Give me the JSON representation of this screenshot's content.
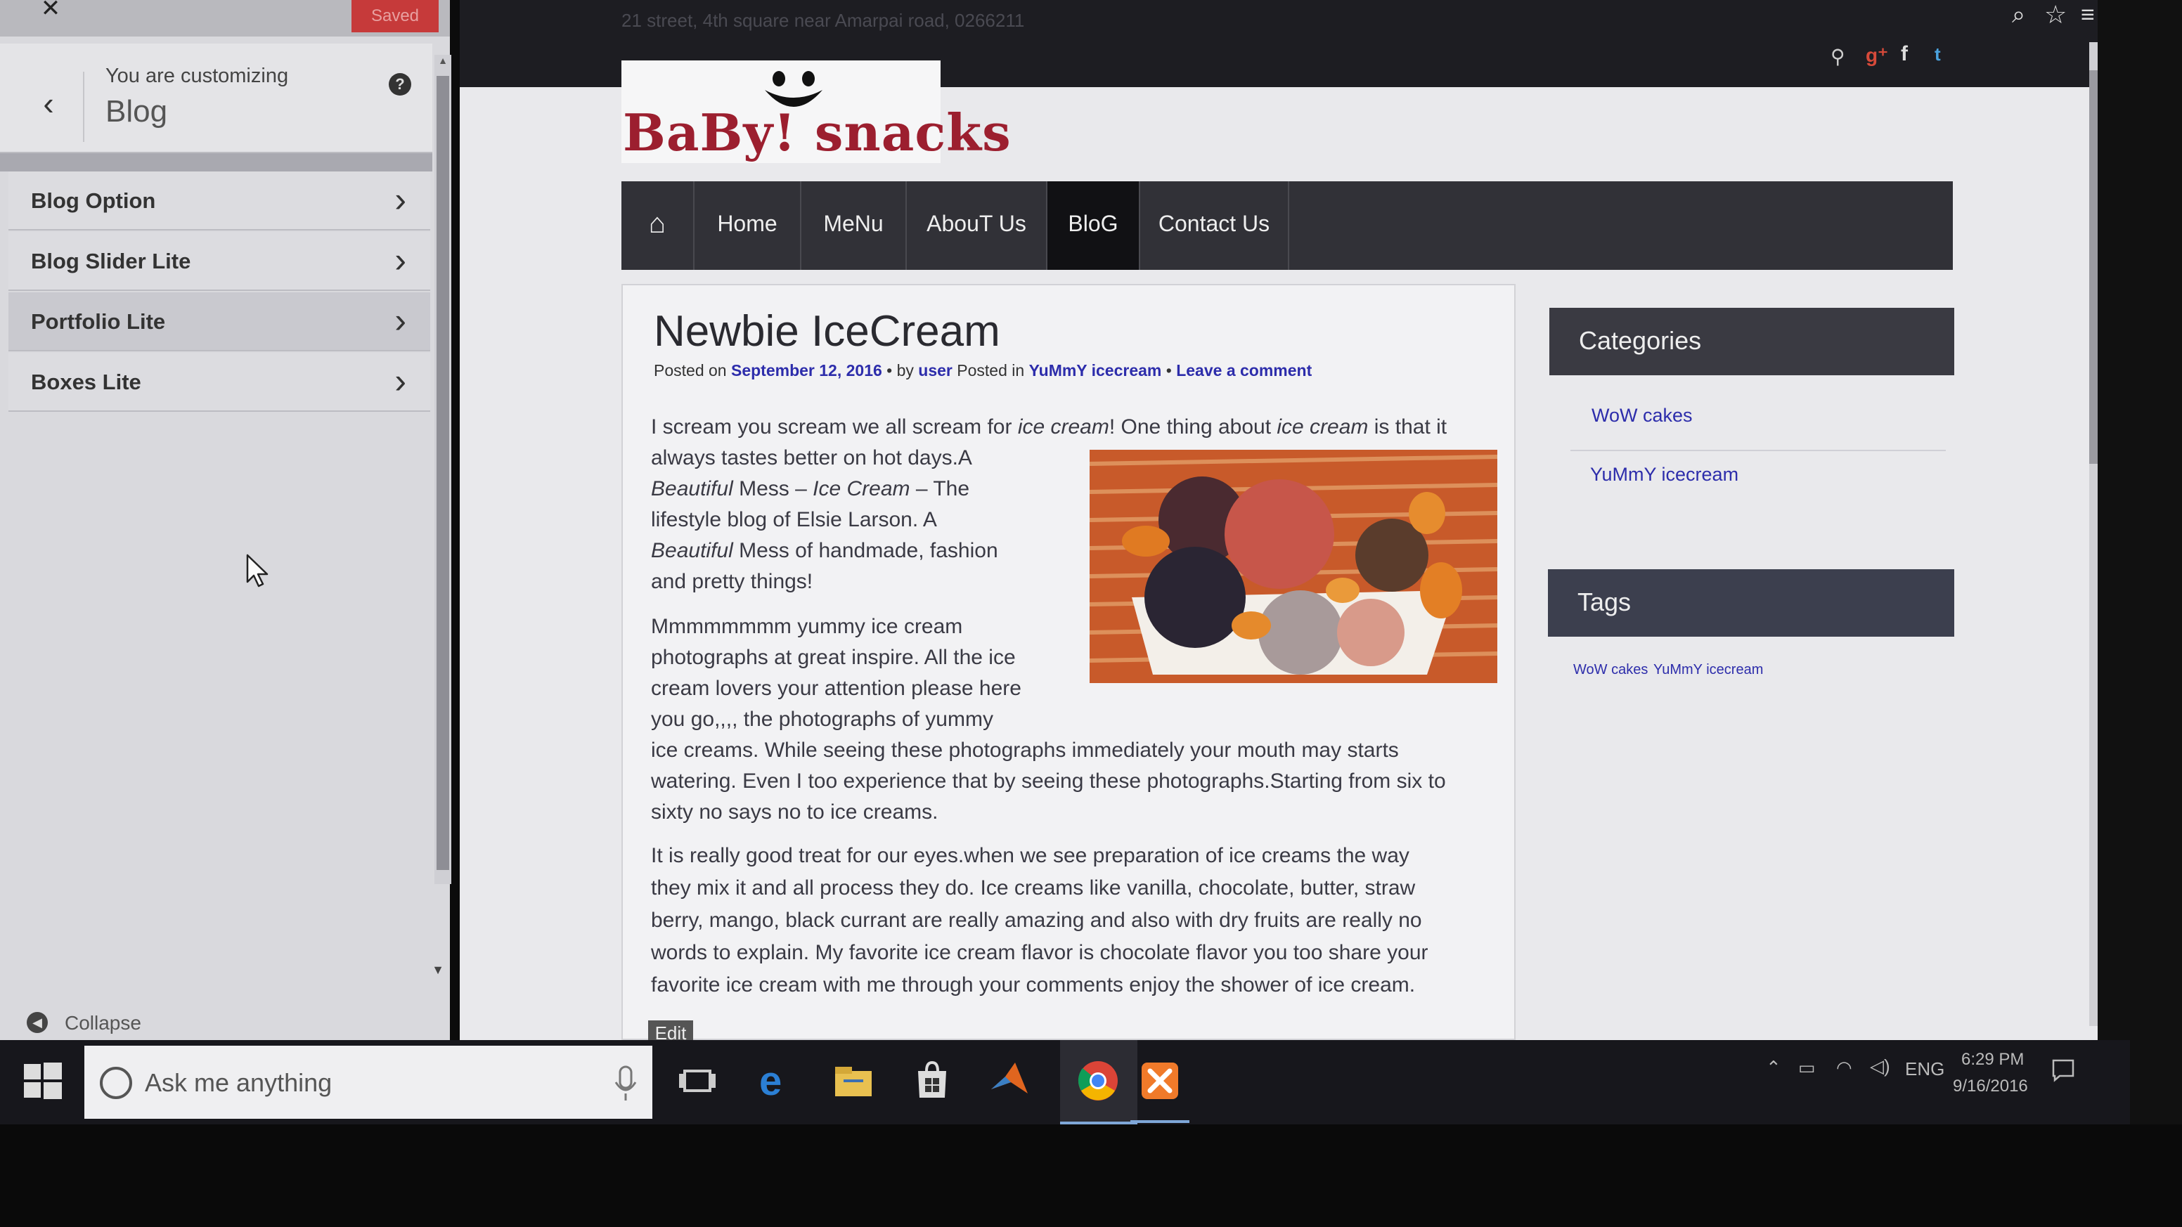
{
  "customizer": {
    "close_icon": "close-icon",
    "save_label": "Saved",
    "info_label": "You are customizing",
    "info_title": "Blog",
    "help_icon": "?",
    "sections": [
      {
        "label": "Blog Option"
      },
      {
        "label": "Blog Slider Lite"
      },
      {
        "label": "Portfolio Lite"
      },
      {
        "label": "Boxes Lite"
      }
    ],
    "collapse_label": "Collapse"
  },
  "site": {
    "top_address": "21 street, 4th square near Amarpai road, 0266211",
    "logo_text": "BaBy! snacks",
    "nav": {
      "home": "Home",
      "menu": "MeNu",
      "about": "AbouT Us",
      "blog": "BloG",
      "contact": "Contact Us"
    },
    "post": {
      "title": "Newbie IceCream",
      "meta_posted_on": "Posted on",
      "meta_date": "September 12, 2016",
      "meta_by": "• by",
      "meta_author": "user",
      "meta_posted_in": "Posted in",
      "meta_category": "YuMmY icecream",
      "meta_sep": "•",
      "meta_comment": "Leave a comment",
      "edit_label": "Edit"
    },
    "sidebar": {
      "categories_title": "Categories",
      "categories": [
        "WoW cakes",
        "YuMmY icecream"
      ],
      "tags_title": "Tags",
      "tags": [
        "WoW cakes",
        "YuMmY icecream"
      ]
    }
  },
  "taskbar": {
    "search_placeholder": "Ask me anything",
    "tray_lang": "ENG",
    "time": "6:29 PM",
    "date": "9/16/2016"
  },
  "colors": {
    "nav_bg": "#313137",
    "nav_active": "#111114",
    "link": "#2d2dab",
    "logo": "#9c1f2f",
    "save_button": "#c63a3a"
  }
}
